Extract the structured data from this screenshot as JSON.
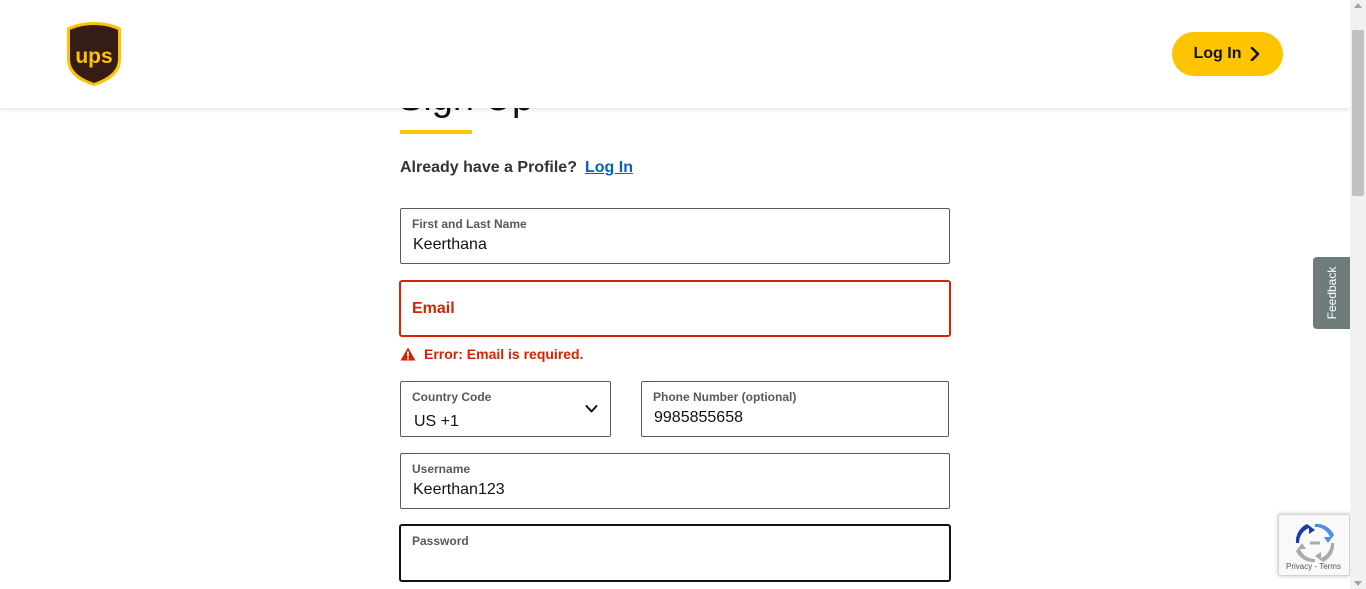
{
  "header": {
    "logo_alt": "UPS",
    "login_button": "Log In"
  },
  "form": {
    "title": "Sign Up",
    "already_text": "Already have a Profile?",
    "already_link": "Log In",
    "name_field": {
      "label": "First and Last Name",
      "value": "Keerthana"
    },
    "email_field": {
      "label": "Email",
      "value": ""
    },
    "email_error": "Error: Email is required.",
    "country_field": {
      "label": "Country Code",
      "value": "US +1"
    },
    "phone_field": {
      "label": "Phone Number (optional)",
      "value": "9985855658"
    },
    "username_field": {
      "label": "Username",
      "value": "Keerthan123"
    },
    "password_field": {
      "label": "Password",
      "value": ""
    }
  },
  "feedback_tab": "Feedback",
  "recaptcha": {
    "links": "Privacy - Terms"
  },
  "colors": {
    "accent": "#ffc400",
    "brand_brown": "#351c15",
    "error": "#d62300",
    "link": "#0662bb"
  }
}
